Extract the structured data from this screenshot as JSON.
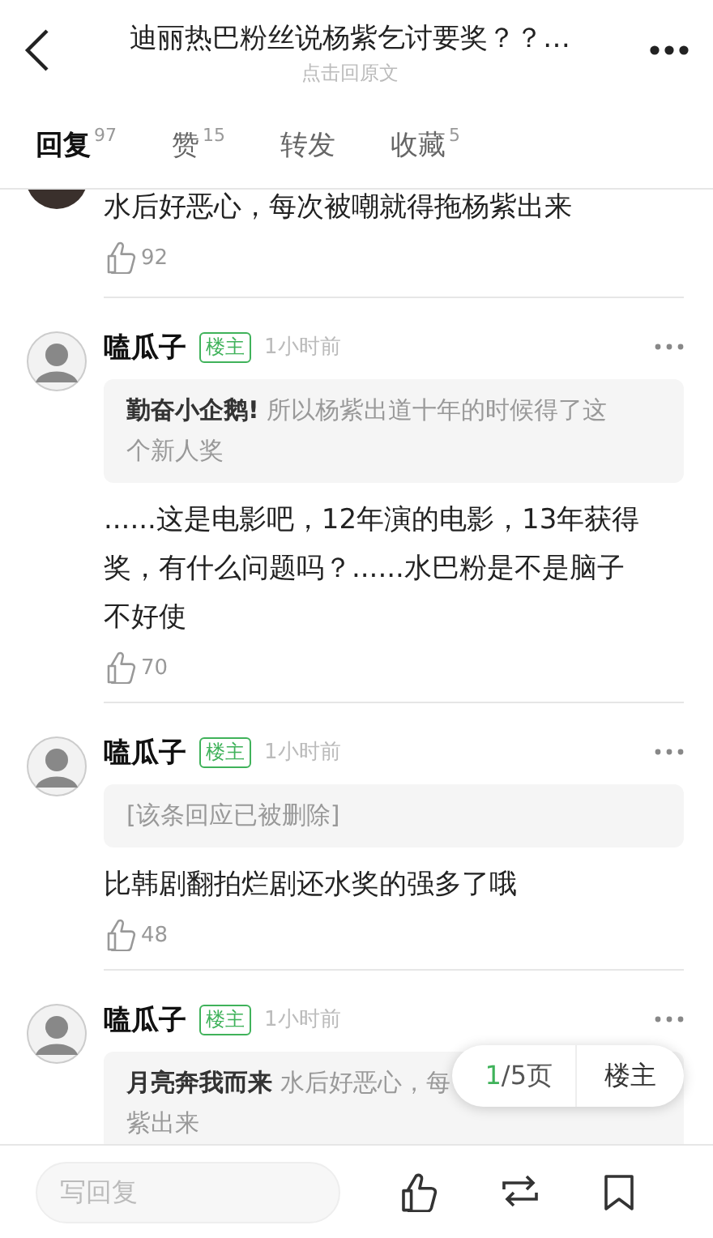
{
  "header": {
    "title": "迪丽热巴粉丝说杨紫乞讨要奖？？…",
    "subtitle": "点击回原文"
  },
  "tabs": [
    {
      "label": "回复",
      "count": "97",
      "selected": true
    },
    {
      "label": "赞",
      "count": "15",
      "selected": false
    },
    {
      "label": "转发",
      "selected": false
    },
    {
      "label": "收藏",
      "count": "5",
      "selected": false
    }
  ],
  "comments": [
    {
      "kind": "partial",
      "text": "水后好恶心，每次被嘲就得拖杨紫出来",
      "likes": "92"
    },
    {
      "kind": "full",
      "author": "嗑瓜子",
      "badge": "楼主",
      "time": "1小时前",
      "quote": {
        "kind": "reply",
        "text": "**勤奋小企鹅!**  所以杨紫出道十年的时候得了这个新人奖"
      },
      "text": "......这是电影吧，12年演的电影，13年获得奖，有什么问题吗？......水巴粉是不是脑子不好使",
      "likes": "70"
    },
    {
      "kind": "full",
      "author": "嗑瓜子",
      "badge": "楼主",
      "time": "1小时前",
      "quote": {
        "kind": "deleted",
        "text": "[该条回应已被删除]"
      },
      "text": "比韩剧翻拍烂剧还水奖的强多了哦",
      "likes": "48"
    },
    {
      "kind": "full",
      "author": "嗑瓜子",
      "badge": "楼主",
      "time": "1小时前",
      "quote": {
        "kind": "reply",
        "lines": [
          "**月亮奔我而来** 水后好恶心，每",
          "紫出来"
        ]
      }
    }
  ],
  "pager": {
    "current": "1",
    "total": "/5页",
    "button": "楼主"
  },
  "reply_bar": {
    "placeholder": "写回复"
  }
}
